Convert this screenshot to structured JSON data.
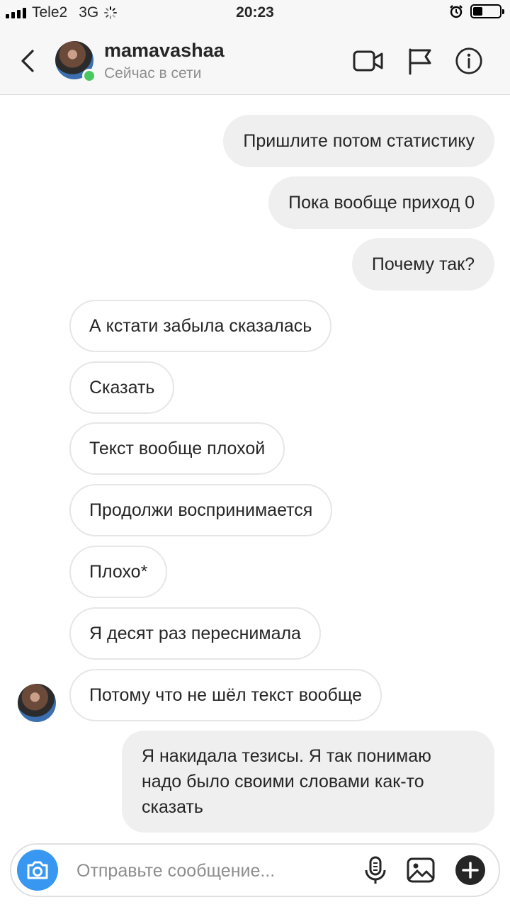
{
  "status_bar": {
    "carrier": "Tele2",
    "network": "3G",
    "time": "20:23",
    "battery_level": 0.35
  },
  "header": {
    "username": "mamavashaa",
    "presence": "Сейчас в сети",
    "icons": [
      "back-chevron-icon",
      "video-call-icon",
      "flag-icon",
      "info-icon"
    ]
  },
  "messages": [
    {
      "side": "out",
      "text": "Пришлите потом статистику"
    },
    {
      "side": "out",
      "text": "Пока вообще приход 0"
    },
    {
      "side": "out",
      "text": "Почему так?"
    },
    {
      "side": "in",
      "text": "А кстати забыла сказалась"
    },
    {
      "side": "in",
      "text": "Сказать"
    },
    {
      "side": "in",
      "text": "Текст вообще плохой"
    },
    {
      "side": "in",
      "text": "Продолжи воспринимается"
    },
    {
      "side": "in",
      "text": "Плохо*"
    },
    {
      "side": "in",
      "text": "Я десят раз переснимала"
    },
    {
      "side": "in",
      "text": "Потому что не шёл текст вообще"
    },
    {
      "side": "out",
      "text": "Я накидала тезисы. Я так понимаю надо было своими словами как-то сказать"
    }
  ],
  "composer": {
    "placeholder": "Отправьте сообщение...",
    "value": "",
    "icons": [
      "camera-icon",
      "microphone-icon",
      "gallery-icon",
      "plus-icon"
    ]
  },
  "colors": {
    "accent": "#3897f0",
    "online": "#48c95f",
    "outgoing_bubble": "#efefef"
  }
}
